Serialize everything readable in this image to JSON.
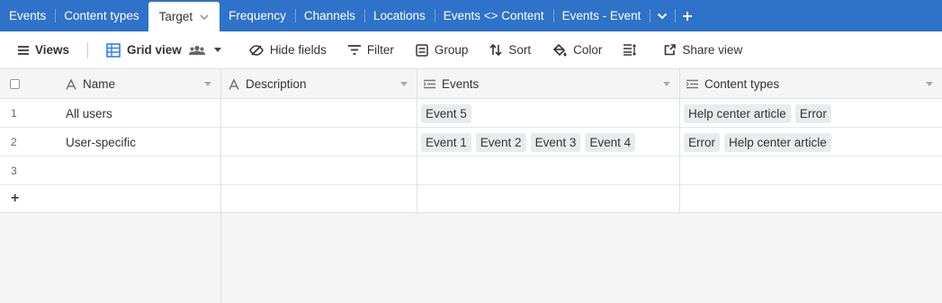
{
  "tabs": [
    "Events",
    "Content types",
    "Target",
    "Frequency",
    "Channels",
    "Locations",
    "Events <> Content",
    "Events - Event"
  ],
  "active_tab_index": 2,
  "toolbar": {
    "views_label": "Views",
    "view_name": "Grid view",
    "hide_fields": "Hide fields",
    "filter": "Filter",
    "group": "Group",
    "sort": "Sort",
    "color": "Color",
    "share_view": "Share view"
  },
  "columns": {
    "name": "Name",
    "description": "Description",
    "events": "Events",
    "content_types": "Content types"
  },
  "rows": [
    {
      "num": "1",
      "name": "All users",
      "description": "",
      "events": [
        "Event 5"
      ],
      "content_types": [
        "Help center article",
        "Error"
      ]
    },
    {
      "num": "2",
      "name": "User-specific",
      "description": "",
      "events": [
        "Event 1",
        "Event 2",
        "Event 3",
        "Event 4"
      ],
      "content_types": [
        "Error",
        "Help center article"
      ]
    },
    {
      "num": "3",
      "name": "",
      "description": "",
      "events": [],
      "content_types": []
    }
  ],
  "add_row_label": "+",
  "colors": {
    "tabbar": "#2f72c9",
    "accent": "#2d7ff9",
    "pill": "#e9ebef"
  }
}
